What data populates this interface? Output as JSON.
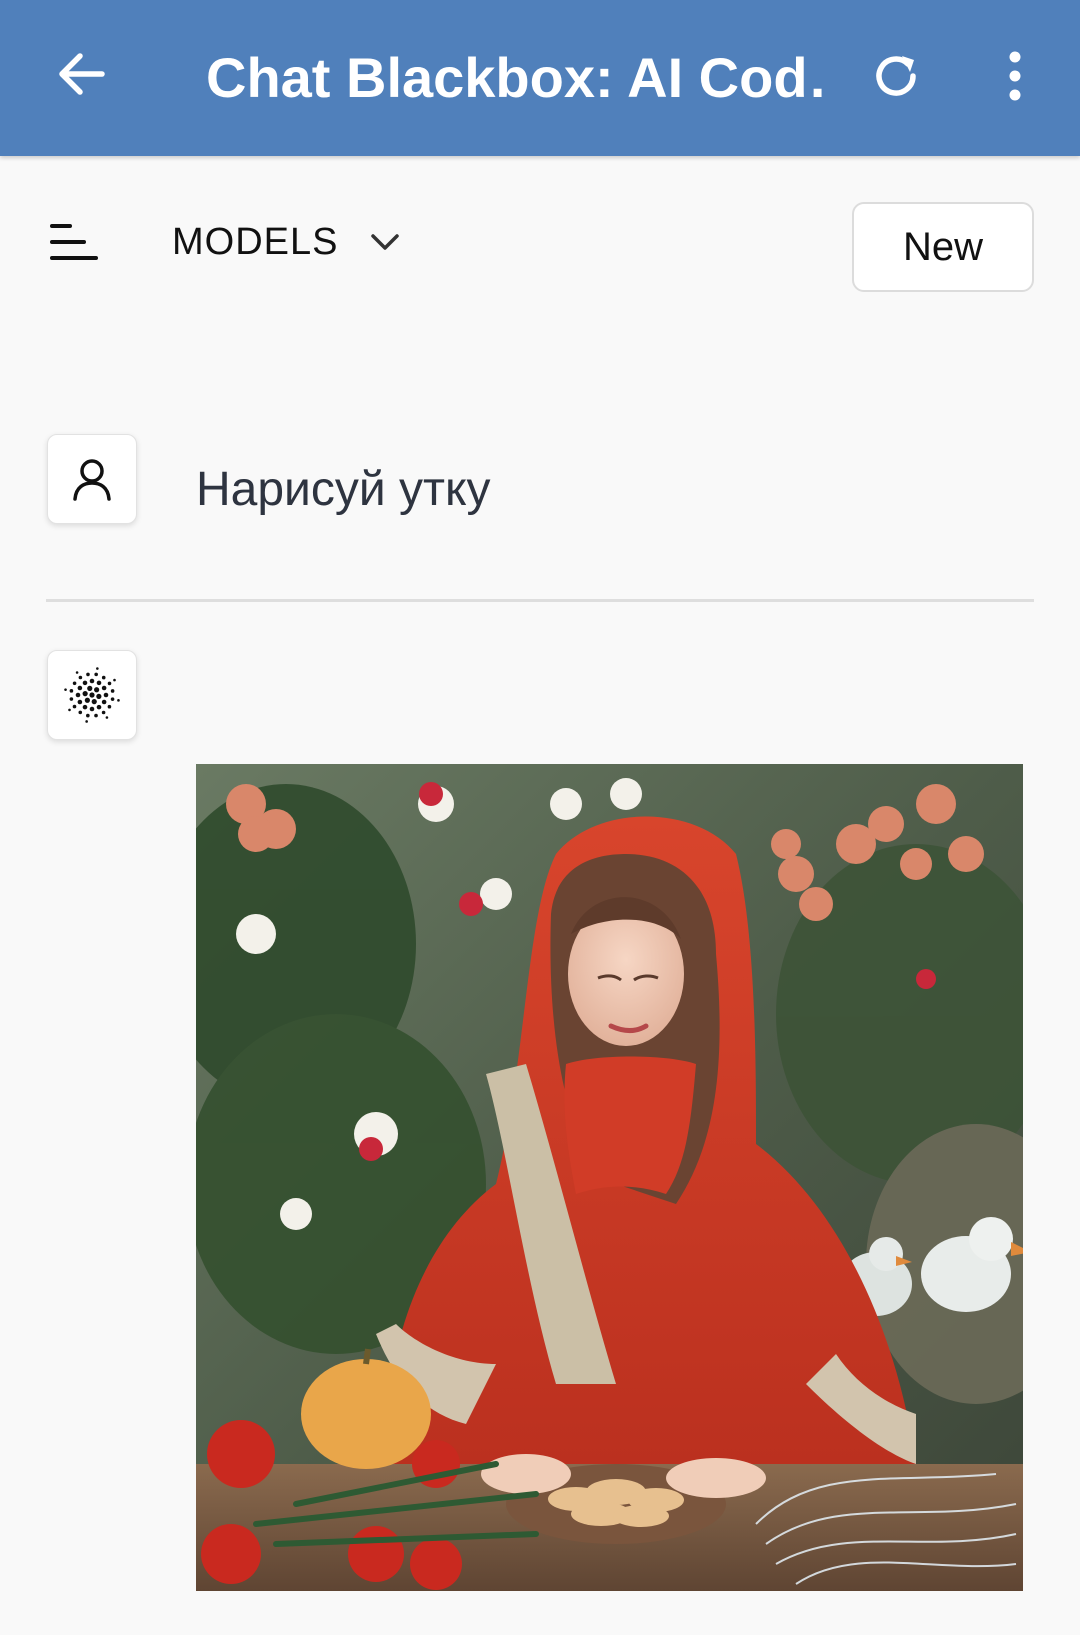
{
  "topbar": {
    "title": "Chat Blackbox: AI Cod…",
    "back_icon": "arrow-left-icon",
    "refresh_icon": "refresh-icon",
    "menu_icon": "more-vertical-icon",
    "background_color": "#5080bb"
  },
  "toolbar": {
    "sidebar_icon": "sidebar-menu-icon",
    "models_label": "MODELS",
    "models_chevron_icon": "chevron-down-icon",
    "new_button_label": "New"
  },
  "conversation": {
    "user_message": {
      "avatar_icon": "user-icon",
      "text": "Нарисуй утку"
    },
    "assistant_message": {
      "avatar_icon": "blackbox-logo-icon",
      "image_description_icon": "generated-image"
    }
  }
}
